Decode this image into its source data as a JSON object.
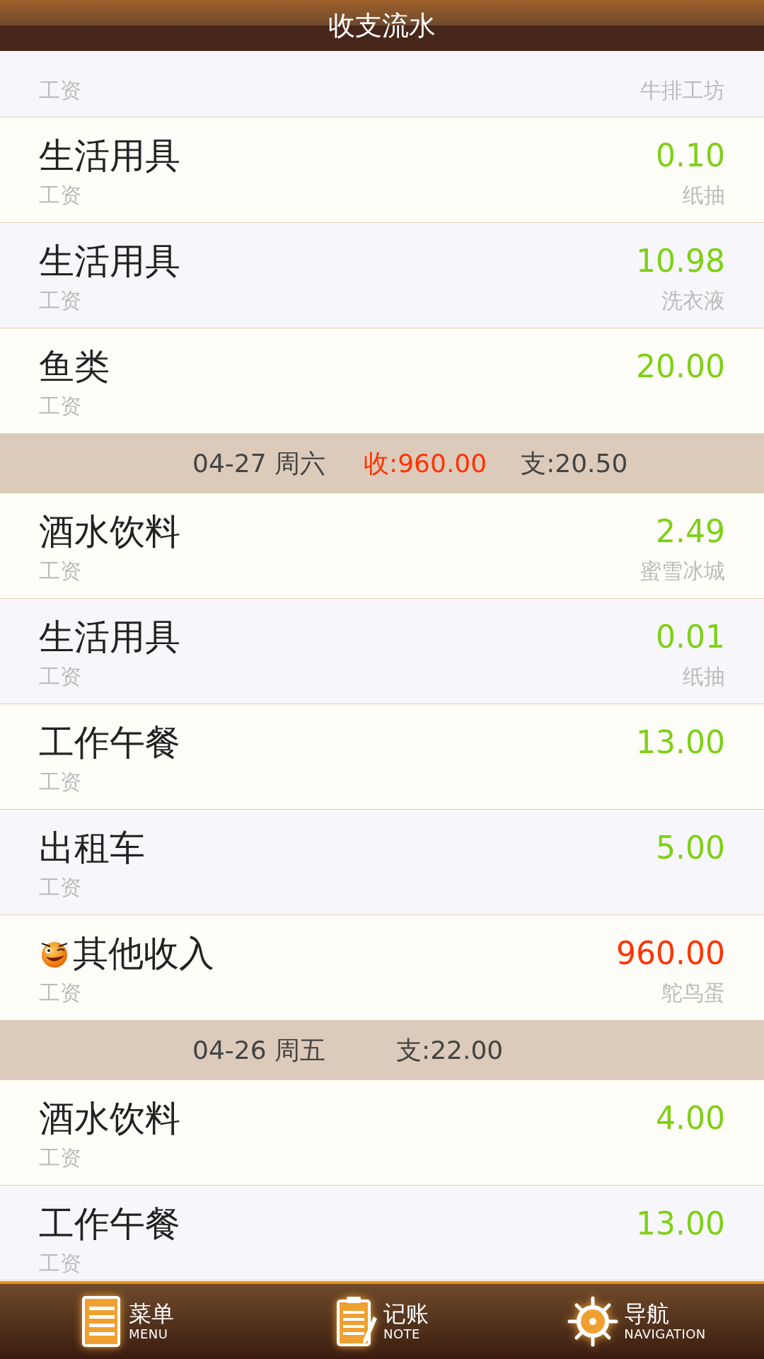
{
  "header": {
    "title": "收支流水"
  },
  "list": [
    {
      "kind": "expense",
      "account": "工资",
      "note": "牛排工坊"
    },
    {
      "kind": "expense",
      "category": "生活用具",
      "amount": "0.10",
      "account": "工资",
      "note": "纸抽"
    },
    {
      "kind": "expense",
      "category": "生活用具",
      "amount": "10.98",
      "account": "工资",
      "note": "洗衣液"
    },
    {
      "kind": "expense",
      "category": "鱼类",
      "amount": "20.00",
      "account": "工资"
    },
    {
      "kind": "day",
      "date": "04-27 周六",
      "income": "收:960.00",
      "expense": "支:20.50"
    },
    {
      "kind": "expense",
      "category": "酒水饮料",
      "amount": "2.49",
      "account": "工资",
      "note": "蜜雪冰城"
    },
    {
      "kind": "expense",
      "category": "生活用具",
      "amount": "0.01",
      "account": "工资",
      "note": "纸抽"
    },
    {
      "kind": "expense",
      "category": "工作午餐",
      "amount": "13.00",
      "account": "工资"
    },
    {
      "kind": "expense",
      "category": "出租车",
      "amount": "5.00",
      "account": "工资"
    },
    {
      "kind": "income",
      "category": "其他收入",
      "amount": "960.00",
      "account": "工资",
      "note": "鸵鸟蛋"
    },
    {
      "kind": "day",
      "date": "04-26 周五",
      "expense": "支:22.00"
    },
    {
      "kind": "expense",
      "category": "酒水饮料",
      "amount": "4.00",
      "account": "工资"
    },
    {
      "kind": "expense",
      "category": "工作午餐",
      "amount": "13.00",
      "account": "工资"
    }
  ],
  "tabbar": [
    {
      "kind": "menu",
      "label": "菜单",
      "sublabel": "MENU"
    },
    {
      "kind": "note",
      "label": "记账",
      "sublabel": "NOTE"
    },
    {
      "kind": "navigation",
      "label": "导航",
      "sublabel": "NAVIGATION"
    }
  ]
}
